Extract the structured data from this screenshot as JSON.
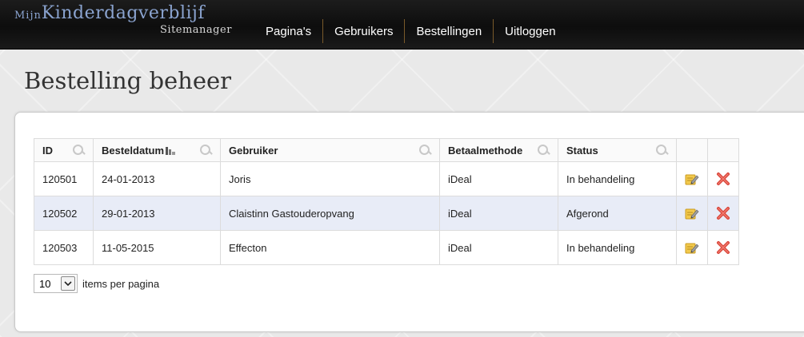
{
  "header": {
    "logo_prefix": "Mijn",
    "logo_main": "Kinderdagverblijf",
    "logo_sub": "Sitemanager",
    "nav": [
      {
        "label": "Pagina's"
      },
      {
        "label": "Gebruikers"
      },
      {
        "label": "Bestellingen"
      },
      {
        "label": "Uitloggen"
      }
    ]
  },
  "page": {
    "title": "Bestelling beheer"
  },
  "table": {
    "columns": [
      "ID",
      "Besteldatum",
      "Gebruiker",
      "Betaalmethode",
      "Status"
    ],
    "rows": [
      {
        "id": "120501",
        "date": "24-01-2013",
        "user": "Joris",
        "payment": "iDeal",
        "status": "In behandeling"
      },
      {
        "id": "120502",
        "date": "29-01-2013",
        "user": "Claistinn Gastouderopvang",
        "payment": "iDeal",
        "status": "Afgerond"
      },
      {
        "id": "120503",
        "date": "11-05-2015",
        "user": "Effecton",
        "payment": "iDeal",
        "status": "In behandeling"
      }
    ]
  },
  "pager": {
    "page_size": "10",
    "label": "items per pagina"
  },
  "colors": {
    "accent_text": "#8aa3cf",
    "row_highlight": "#e8ecf7",
    "delete": "#d9453a",
    "edit": "#e8b730"
  }
}
